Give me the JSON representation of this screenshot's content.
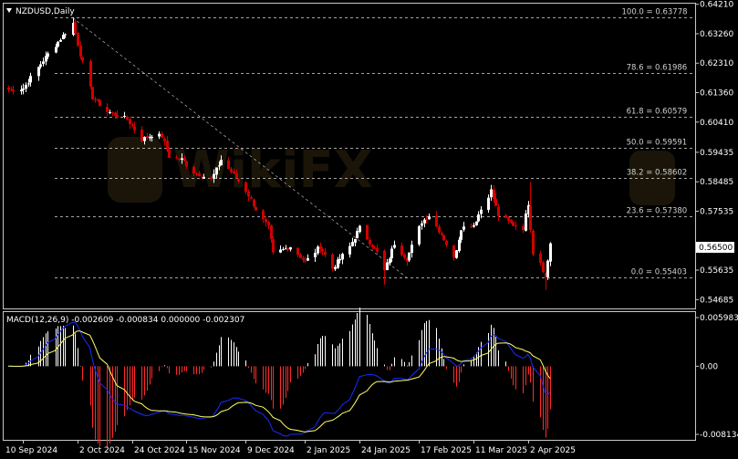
{
  "header": {
    "symbol": "NZDUSD,Daily",
    "macd_label": "MACD(12,26,9) -0.002609 -0.000834 0.000000 -0.002307"
  },
  "colors": {
    "background": "#000000",
    "frame": "#c8c8c8",
    "bull_candle": "#ffffff",
    "bear_candle": "#d00000",
    "macd_positive": "#ffffff",
    "macd_negative": "#ff2a2a",
    "macd_line": "#1a2bff",
    "signal_line": "#ffff66",
    "fib_line": "#ffffff",
    "current_price_box": "#ffffff"
  },
  "chart_data": [
    {
      "type": "candlestick",
      "title": "NZDUSD,Daily",
      "price_axis_ticks": [
        "0.64210",
        "0.63260",
        "0.62310",
        "0.61360",
        "0.60410",
        "0.59435",
        "0.58485",
        "0.57535",
        "0.56500",
        "0.55635",
        "0.54685"
      ],
      "ylim": [
        0.544,
        0.6423
      ],
      "current_price": "0.56500",
      "x_ticks": [
        "10 Sep 2024",
        "2 Oct 2024",
        "24 Oct 2024",
        "15 Nov 2024",
        "9 Dec 2024",
        "2 Jan 2025",
        "24 Jan 2025",
        "17 Feb 2025",
        "11 Mar 2025",
        "2 Apr 2025"
      ],
      "fibonacci": [
        {
          "label": "100.0 = 0.63778",
          "value": 0.63778
        },
        {
          "label": "78.6 = 0.61986",
          "value": 0.61986
        },
        {
          "label": "61.8 = 0.60579",
          "value": 0.60579
        },
        {
          "label": "50.0 = 0.59591",
          "value": 0.59591
        },
        {
          "label": "38.2 = 0.58602",
          "value": 0.58602
        },
        {
          "label": "23.6 = 0.57380",
          "value": 0.5738
        },
        {
          "label": "0.0 = 0.55403",
          "value": 0.55403
        }
      ],
      "trend_line": {
        "from_date": "30 Sep 2024",
        "from_price": 0.6378,
        "to_date": "12 Feb 2025",
        "to_price": 0.554
      },
      "anchors": [
        [
          "2024-09-04",
          0.6145
        ],
        [
          "2024-09-10",
          0.615
        ],
        [
          "2024-09-18",
          0.624
        ],
        [
          "2024-09-26",
          0.632
        ],
        [
          "2024-09-30",
          0.636
        ],
        [
          "2024-10-03",
          0.626
        ],
        [
          "2024-10-08",
          0.612
        ],
        [
          "2024-10-14",
          0.6075
        ],
        [
          "2024-10-22",
          0.605
        ],
        [
          "2024-10-28",
          0.5985
        ],
        [
          "2024-11-01",
          0.6
        ],
        [
          "2024-11-05",
          0.5995
        ],
        [
          "2024-11-08",
          0.593
        ],
        [
          "2024-11-13",
          0.592
        ],
        [
          "2024-11-18",
          0.588
        ],
        [
          "2024-11-25",
          0.5855
        ],
        [
          "2024-11-29",
          0.592
        ],
        [
          "2024-12-03",
          0.588
        ],
        [
          "2024-12-09",
          0.582
        ],
        [
          "2024-12-13",
          0.576
        ],
        [
          "2024-12-18",
          0.57
        ],
        [
          "2024-12-20",
          0.5615
        ],
        [
          "2024-12-27",
          0.564
        ],
        [
          "2025-01-02",
          0.559
        ],
        [
          "2025-01-08",
          0.564
        ],
        [
          "2025-01-13",
          0.557
        ],
        [
          "2025-01-20",
          0.564
        ],
        [
          "2025-01-24",
          0.57
        ],
        [
          "2025-01-31",
          0.562
        ],
        [
          "2025-02-03",
          0.556
        ],
        [
          "2025-02-07",
          0.565
        ],
        [
          "2025-02-12",
          0.56
        ],
        [
          "2025-02-18",
          0.572
        ],
        [
          "2025-02-21",
          0.574
        ],
        [
          "2025-02-26",
          0.568
        ],
        [
          "2025-03-03",
          0.56
        ],
        [
          "2025-03-06",
          0.57
        ],
        [
          "2025-03-11",
          0.571
        ],
        [
          "2025-03-14",
          0.576
        ],
        [
          "2025-03-18",
          0.582
        ],
        [
          "2025-03-21",
          0.574
        ],
        [
          "2025-03-27",
          0.571
        ],
        [
          "2025-03-31",
          0.57
        ],
        [
          "2025-04-02",
          0.578
        ],
        [
          "2025-04-04",
          0.562
        ],
        [
          "2025-04-07",
          0.559
        ],
        [
          "2025-04-09",
          0.554
        ],
        [
          "2025-04-11",
          0.565
        ]
      ]
    },
    {
      "type": "macd",
      "title": "MACD(12,26,9)",
      "values": {
        "main": -0.002609,
        "signal": -0.000834,
        "third": 0.0,
        "histogram": -0.002307
      },
      "ticks": [
        "0.005983",
        "0.00",
        "-0.008134"
      ],
      "ylim": [
        -0.008134,
        0.005983
      ],
      "series": [
        {
          "name": "macd_histogram",
          "color": "#ff2a2a"
        },
        {
          "name": "macd_line",
          "color": "#1a2bff"
        },
        {
          "name": "signal_line",
          "color": "#ffff66"
        }
      ]
    }
  ]
}
